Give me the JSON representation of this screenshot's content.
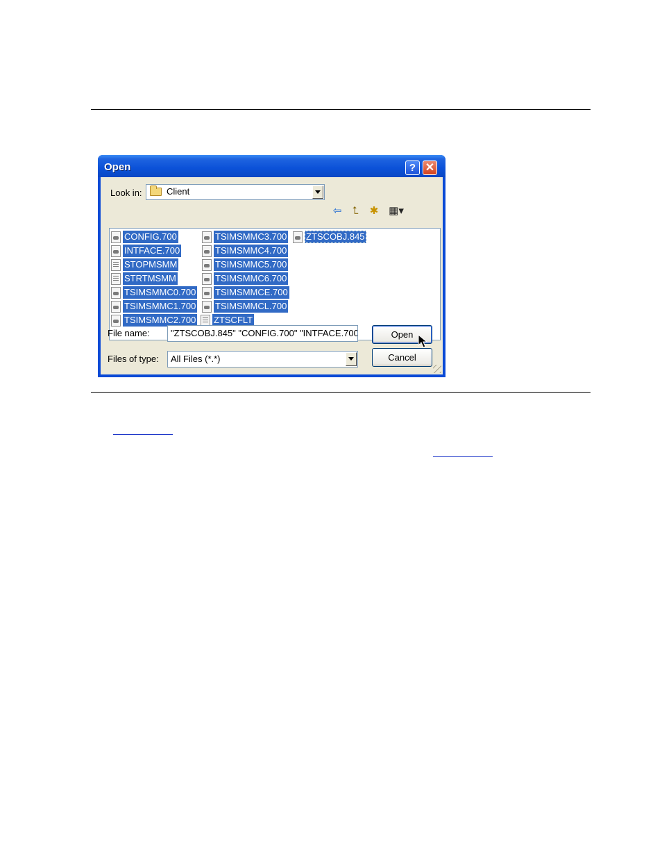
{
  "dialog": {
    "title": "Open",
    "help_glyph": "?",
    "close_glyph": "✕"
  },
  "look_in": {
    "label": "Look in:",
    "value": "Client",
    "icon": "folder-icon"
  },
  "toolbar": {
    "back_icon": "⇦",
    "up_icon": "⮤",
    "new_folder_icon": "✱",
    "views_icon": "▦▾"
  },
  "files": [
    {
      "name": "CONFIG.700",
      "icon": "system-file-icon"
    },
    {
      "name": "INTFACE.700",
      "icon": "system-file-icon"
    },
    {
      "name": "STOPMSMM",
      "icon": "text-file-icon"
    },
    {
      "name": "STRTMSMM",
      "icon": "text-file-icon"
    },
    {
      "name": "TSIMSMMC0.700",
      "icon": "system-file-icon"
    },
    {
      "name": "TSIMSMMC1.700",
      "icon": "system-file-icon"
    },
    {
      "name": "TSIMSMMC2.700",
      "icon": "system-file-icon"
    },
    {
      "name": "TSIMSMMC3.700",
      "icon": "system-file-icon"
    },
    {
      "name": "TSIMSMMC4.700",
      "icon": "system-file-icon"
    },
    {
      "name": "TSIMSMMC5.700",
      "icon": "system-file-icon"
    },
    {
      "name": "TSIMSMMC6.700",
      "icon": "system-file-icon"
    },
    {
      "name": "TSIMSMMCE.700",
      "icon": "system-file-icon"
    },
    {
      "name": "TSIMSMMCL.700",
      "icon": "system-file-icon"
    },
    {
      "name": "ZTSCFLT",
      "icon": "text-file-icon"
    },
    {
      "name": "ZTSCOBJ.845",
      "icon": "system-file-icon"
    }
  ],
  "file_name": {
    "label": "File name:",
    "value": "\"ZTSCOBJ.845\" \"CONFIG.700\" \"INTFACE.700"
  },
  "file_type": {
    "label": "Files of type:",
    "value": "All Files (*.*)"
  },
  "buttons": {
    "open": "Open",
    "cancel": "Cancel"
  },
  "colors": {
    "title_bar": "#0a4ad6",
    "selection": "#316ac5",
    "dialog_face": "#ece9d8"
  }
}
